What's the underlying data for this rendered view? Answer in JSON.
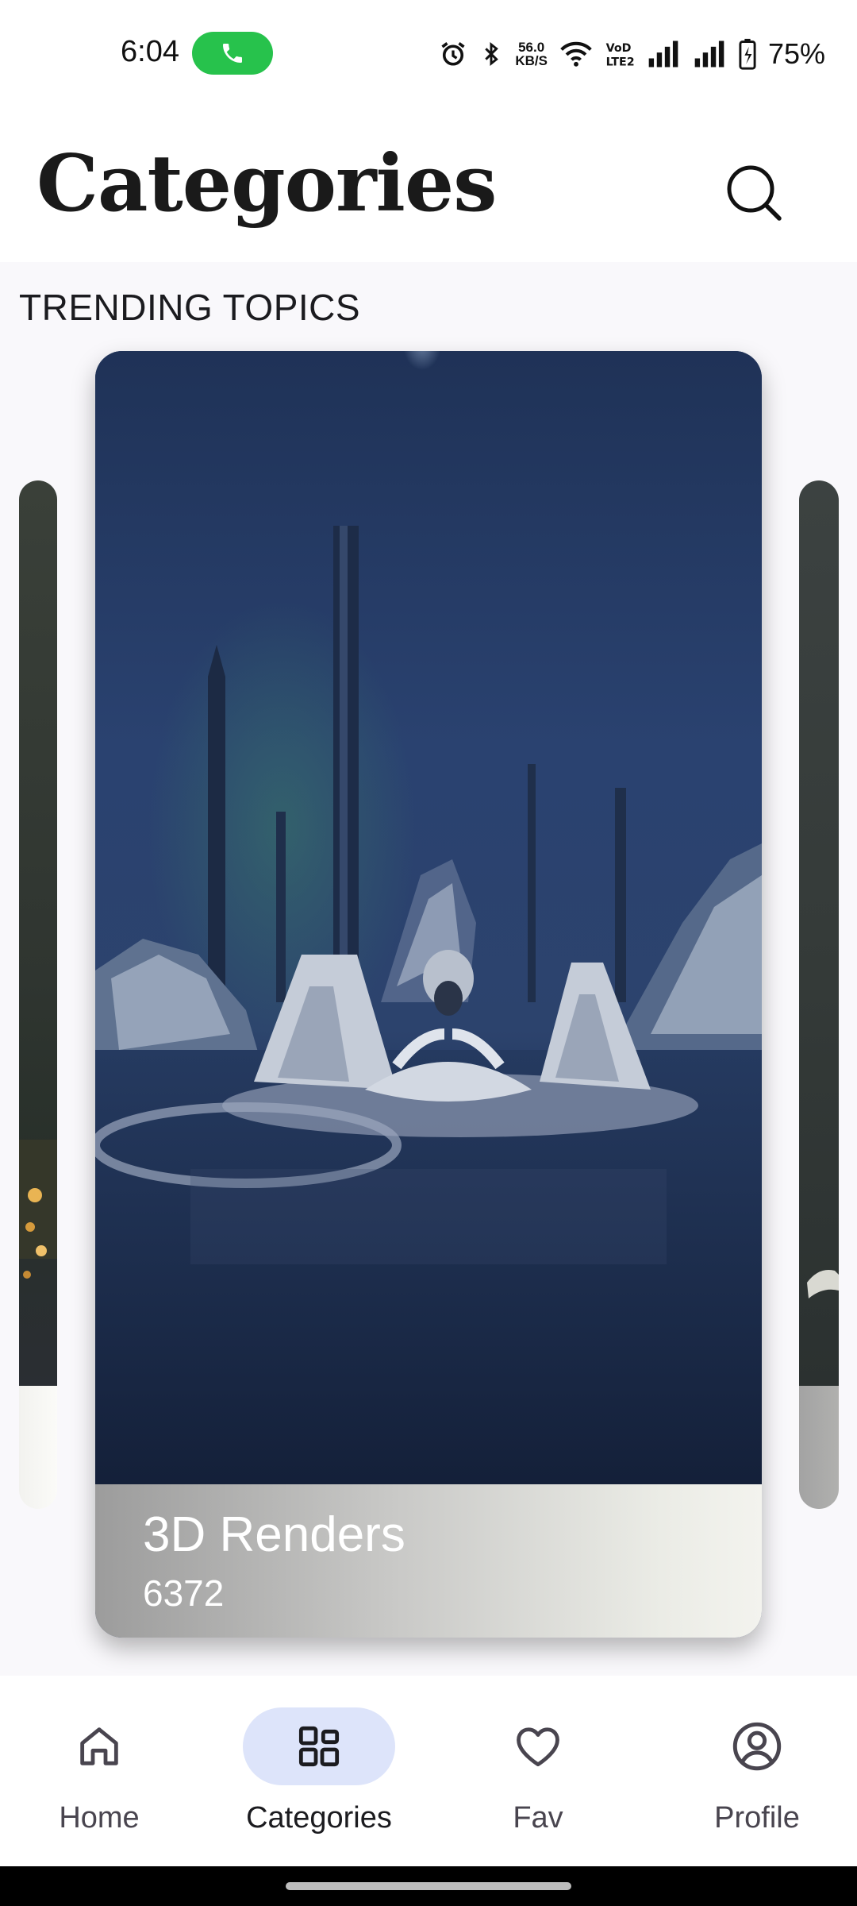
{
  "status_bar": {
    "time": "6:04",
    "network_speed_value": "56.0",
    "network_speed_unit": "KB/S",
    "battery_percent": "75%",
    "call_pill_color": "#27c24c",
    "icons": [
      "phone-icon",
      "alarm-icon",
      "bluetooth-icon",
      "wifi-icon",
      "volte-icon",
      "signal-icon",
      "signal-icon",
      "battery-charging-icon"
    ]
  },
  "header": {
    "title": "Categories",
    "search_icon": "search-icon"
  },
  "trending": {
    "section_title": "TRENDING TOPICS",
    "featured": {
      "name": "3D Renders",
      "count": "6372"
    }
  },
  "bottom_nav": {
    "active_color": "#dde4fa",
    "items": [
      {
        "label": "Home",
        "icon": "home-icon",
        "active": false
      },
      {
        "label": "Categories",
        "icon": "grid-icon",
        "active": true
      },
      {
        "label": "Fav",
        "icon": "heart-icon",
        "active": false
      },
      {
        "label": "Profile",
        "icon": "profile-icon",
        "active": false
      }
    ]
  }
}
